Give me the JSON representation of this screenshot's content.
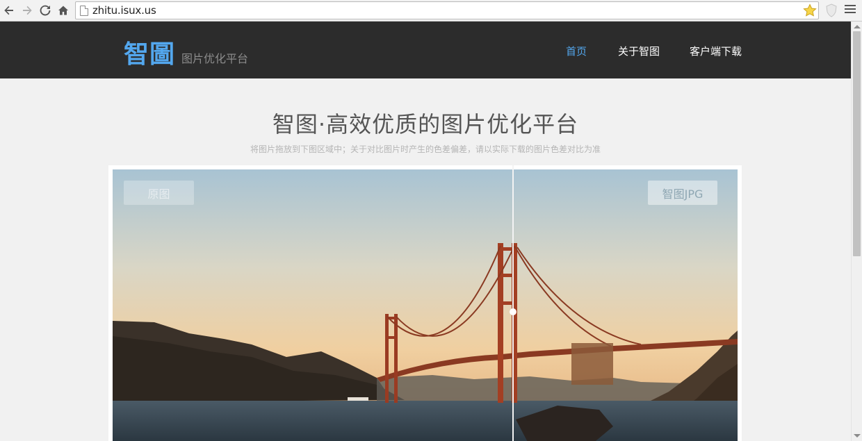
{
  "browser": {
    "url": "zhitu.isux.us"
  },
  "site": {
    "logo": "智圖",
    "tagline": "图片优化平台",
    "nav": [
      "首页",
      "关于智图",
      "客户端下载"
    ]
  },
  "hero": {
    "title": "智图·高效优质的图片优化平台",
    "subtitle": "将图片拖放到下图区域中；关于对比图片时产生的色差偏差，请以实际下载的图片色差对比为准"
  },
  "compare": {
    "left_label": "原图",
    "right_label": "智图JPG"
  },
  "colors": {
    "accent": "#53a7ee",
    "header_bg": "#2c2c2c"
  }
}
